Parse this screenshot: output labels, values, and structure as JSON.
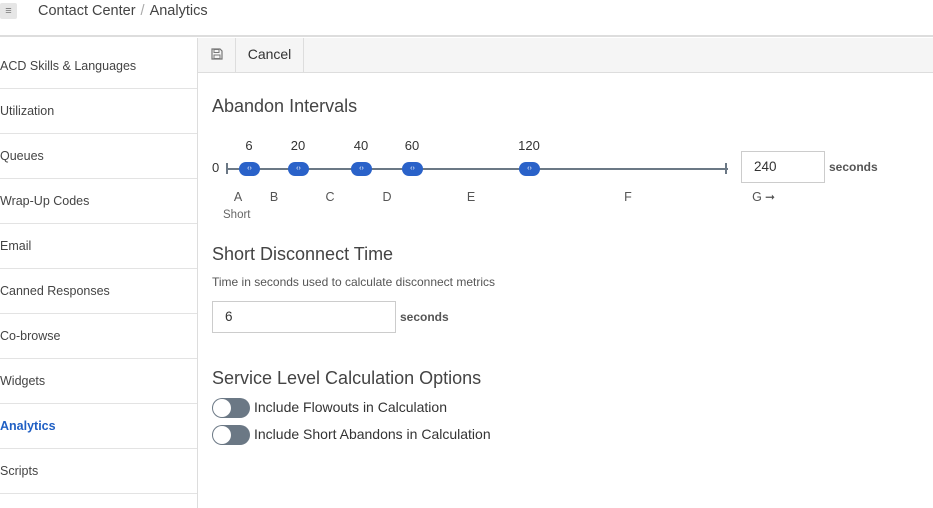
{
  "header": {
    "menu_icon": "hamburger-menu-icon",
    "breadcrumb": [
      "Contact Center",
      "Analytics"
    ],
    "separator": "/"
  },
  "sidebar": {
    "items": [
      {
        "label": "ACD Skills & Languages",
        "active": false
      },
      {
        "label": "Utilization",
        "active": false
      },
      {
        "label": "Queues",
        "active": false
      },
      {
        "label": "Wrap-Up Codes",
        "active": false
      },
      {
        "label": "Email",
        "active": false
      },
      {
        "label": "Canned Responses",
        "active": false
      },
      {
        "label": "Co-browse",
        "active": false
      },
      {
        "label": "Widgets",
        "active": false
      },
      {
        "label": "Analytics",
        "active": true
      },
      {
        "label": "Scripts",
        "active": false
      }
    ]
  },
  "toolbar": {
    "save_icon": "floppy-disk-icon",
    "cancel_label": "Cancel"
  },
  "abandon_intervals": {
    "title": "Abandon Intervals",
    "zero_label": "0",
    "handles": [
      "6",
      "20",
      "40",
      "60",
      "120"
    ],
    "handle_glyph": "‹›",
    "max_value": "240",
    "max_unit": "seconds",
    "zone_labels": [
      "A",
      "B",
      "C",
      "D",
      "E",
      "F",
      "G"
    ],
    "short_label": "Short",
    "arrow_glyph": "➞"
  },
  "short_disconnect": {
    "title": "Short Disconnect Time",
    "description": "Time in seconds used to calculate disconnect metrics",
    "value": "6",
    "unit": "seconds"
  },
  "service_level": {
    "title": "Service Level Calculation Options",
    "toggles": [
      {
        "label": "Include Flowouts in Calculation",
        "on": false
      },
      {
        "label": "Include Short Abandons in Calculation",
        "on": false
      }
    ]
  },
  "colors": {
    "accent": "#2a62c9",
    "track": "#6b7885",
    "active_nav": "#1f5fc4"
  }
}
